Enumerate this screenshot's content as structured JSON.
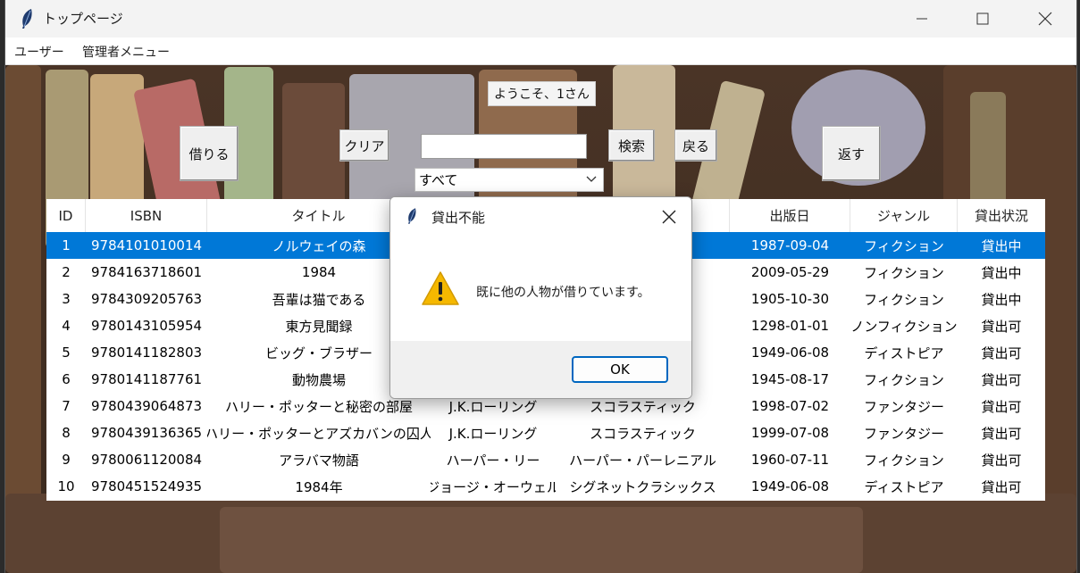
{
  "window": {
    "title": "トップページ",
    "icon": "feather-icon",
    "controls": [
      "minimize-icon",
      "maximize-icon",
      "close-icon"
    ]
  },
  "menubar": {
    "items": [
      {
        "label": "ユーザー"
      },
      {
        "label": "管理者メニュー"
      }
    ]
  },
  "welcome": "ようこそ、1さん",
  "buttons": {
    "borrow": "借りる",
    "clear": "クリア",
    "search": "検索",
    "back": "戻る",
    "return": "返す"
  },
  "search": {
    "value": ""
  },
  "filter": {
    "selected": "すべて"
  },
  "table": {
    "headers": [
      "ID",
      "ISBN",
      "タイトル",
      "",
      "",
      "出版日",
      "ジャンル",
      "貸出状況"
    ],
    "selected_row": 0,
    "rows": [
      [
        "1",
        "9784101010014",
        "ノルウェイの森",
        "",
        "",
        "1987-09-04",
        "フィクション",
        "貸出中"
      ],
      [
        "2",
        "9784163718601",
        "1984",
        "",
        "",
        "2009-05-29",
        "フィクション",
        "貸出中"
      ],
      [
        "3",
        "9784309205763",
        "吾輩は猫である",
        "",
        "",
        "1905-10-30",
        "フィクション",
        "貸出中"
      ],
      [
        "4",
        "9780143105954",
        "東方見聞録",
        "",
        "ス",
        "1298-01-01",
        "ノンフィクション",
        "貸出可"
      ],
      [
        "5",
        "9780141182803",
        "ビッグ・ブラザー",
        "",
        "ス",
        "1949-06-08",
        "ディストピア",
        "貸出可"
      ],
      [
        "6",
        "9780141187761",
        "動物農場",
        "",
        "ス",
        "1945-08-17",
        "フィクション",
        "貸出可"
      ],
      [
        "7",
        "9780439064873",
        "ハリー・ポッターと秘密の部屋",
        "J.K.ローリング",
        "スコラスティック",
        "1998-07-02",
        "ファンタジー",
        "貸出可"
      ],
      [
        "8",
        "9780439136365",
        "ハリー・ポッターとアズカバンの囚人",
        "J.K.ローリング",
        "スコラスティック",
        "1999-07-08",
        "ファンタジー",
        "貸出可"
      ],
      [
        "9",
        "9780061120084",
        "アラバマ物語",
        "ハーパー・リー",
        "ハーパー・パーレニアル",
        "1960-07-11",
        "フィクション",
        "貸出可"
      ],
      [
        "10",
        "9780451524935",
        "1984年",
        "ジョージ・オーウェル",
        "シグネットクラシックス",
        "1949-06-08",
        "ディストピア",
        "貸出可"
      ]
    ]
  },
  "dialog": {
    "title": "貸出不能",
    "icon": "warning-icon",
    "message": "既に他の人物が借りています。",
    "ok_label": "OK"
  },
  "colors": {
    "selection": "#0078d7",
    "dialog_button_border": "#0067c0",
    "warning": "#f5b800"
  }
}
